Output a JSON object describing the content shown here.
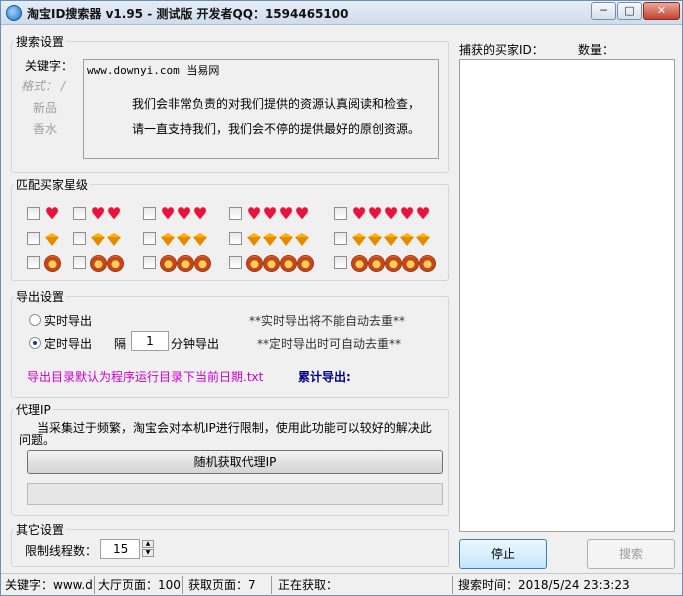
{
  "window": {
    "title": "淘宝ID搜索器 v1.95 - 测试版   开发者QQ：1594465100",
    "min": "─",
    "max": "□",
    "close": "✕"
  },
  "search": {
    "legend": "搜索设置",
    "keyword_label": "关键字：",
    "ghost_format": "格式：  /",
    "ghost_new": "新品",
    "ghost_perfume": "香水",
    "input_line1": "www.downyi.com  当易网",
    "input_line2": "我们会非常负责的对我们提供的资源认真阅读和检查，",
    "input_line3": "请一直支持我们，我们会不停的提供最好的原创资源。"
  },
  "levels": {
    "legend": "匹配买家星级",
    "rows": [
      {
        "type": "heart",
        "counts": [
          1,
          2,
          3,
          4,
          5
        ]
      },
      {
        "type": "diamond",
        "counts": [
          1,
          2,
          3,
          4,
          5
        ]
      },
      {
        "type": "crown",
        "counts": [
          1,
          2,
          3,
          4,
          5
        ]
      }
    ],
    "checked": [
      false,
      false,
      false,
      false,
      false,
      false,
      false,
      false,
      false,
      false,
      false,
      false,
      false,
      false,
      false
    ]
  },
  "export": {
    "legend": "导出设置",
    "realtime_label": "实时导出",
    "timed_label": "定时导出",
    "selected": "timed",
    "interval_prefix": "隔",
    "interval_value": "1",
    "interval_suffix": "分钟导出",
    "realtime_note": "**实时导出将不能自动去重**",
    "timed_note": "**定时导出时可自动去重**",
    "dir_note": "导出目录默认为程序运行目录下当前日期.txt",
    "total_label": "累计导出:",
    "colors": {
      "dir_note": "#cc00cc",
      "total_label": "#000080"
    }
  },
  "proxy": {
    "legend": "代理IP",
    "desc_line1": "当采集过于频繁，淘宝会对本机IP进行限制，使用此功能可以较好的解决此",
    "desc_line2": "问题。",
    "button": "随机获取代理IP"
  },
  "other": {
    "legend": "其它设置",
    "threads_label": "限制线程数：",
    "threads_value": "15"
  },
  "results": {
    "id_label": "捕获的买家ID：",
    "count_label": "数量："
  },
  "buttons": {
    "stop": "停止",
    "search": "搜索"
  },
  "status": {
    "keyword": "关键字：www.d",
    "hall_pages": "大厅页面：100",
    "fetched_pages": "获取页面：7",
    "fetching": "正在获取：",
    "search_time": "搜索时间：2018/5/24 23:3:23"
  }
}
